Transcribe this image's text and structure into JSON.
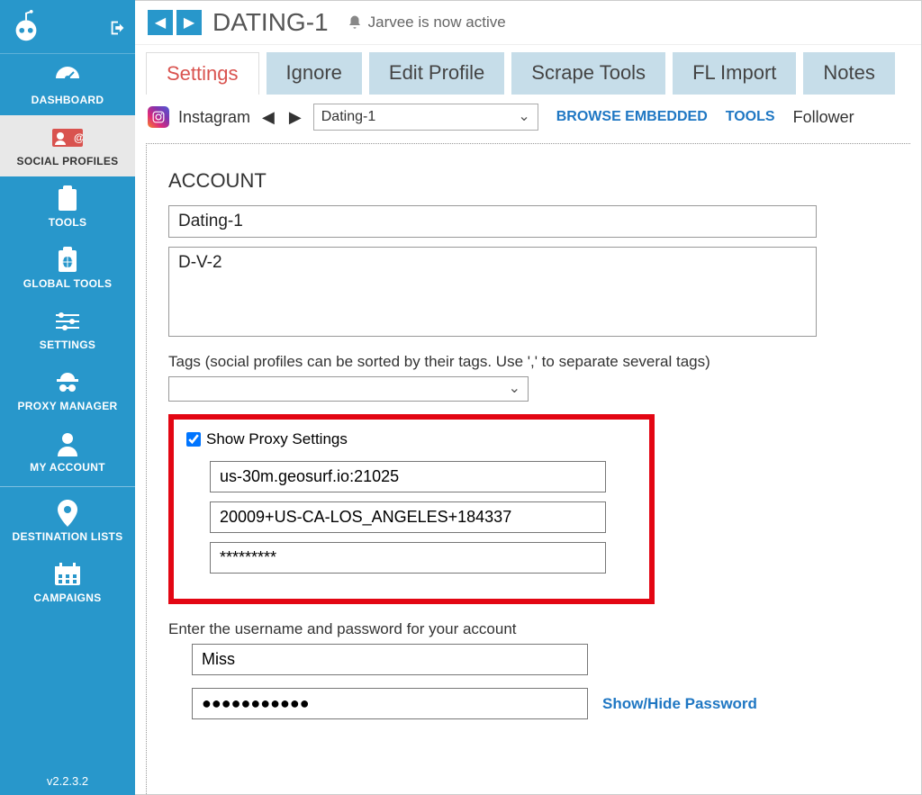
{
  "sidebar": {
    "items": [
      {
        "label": "DASHBOARD"
      },
      {
        "label": "SOCIAL PROFILES"
      },
      {
        "label": "TOOLS"
      },
      {
        "label": "GLOBAL TOOLS"
      },
      {
        "label": "SETTINGS"
      },
      {
        "label": "PROXY MANAGER"
      },
      {
        "label": "MY ACCOUNT"
      },
      {
        "label": "DESTINATION LISTS"
      },
      {
        "label": "CAMPAIGNS"
      }
    ],
    "version": "v2.2.3.2"
  },
  "header": {
    "title": "DATING-1",
    "status": "Jarvee is now active"
  },
  "tabs": {
    "items": [
      {
        "label": "Settings"
      },
      {
        "label": "Ignore"
      },
      {
        "label": "Edit Profile"
      },
      {
        "label": "Scrape Tools"
      },
      {
        "label": "FL Import"
      },
      {
        "label": "Notes"
      }
    ]
  },
  "subbar": {
    "platform": "Instagram",
    "profile_selected": "Dating-1",
    "browse_embedded": "BROWSE EMBEDDED",
    "tools": "TOOLS",
    "follower": "Follower"
  },
  "account": {
    "section_title": "ACCOUNT",
    "name": "Dating-1",
    "desc": "D-V-2",
    "tags_hint": "Tags (social profiles can be sorted by their tags. Use ',' to separate several tags)",
    "proxy": {
      "show_label": "Show Proxy Settings",
      "show_checked": true,
      "host": "us-30m.geosurf.io:21025",
      "user": "20009+US-CA-LOS_ANGELES+184337",
      "pass": "*********"
    },
    "creds_hint": "Enter the username and password for your account",
    "username": "Miss",
    "password_mask": "●●●●●●●●●●●",
    "showhide": "Show/Hide Password"
  }
}
